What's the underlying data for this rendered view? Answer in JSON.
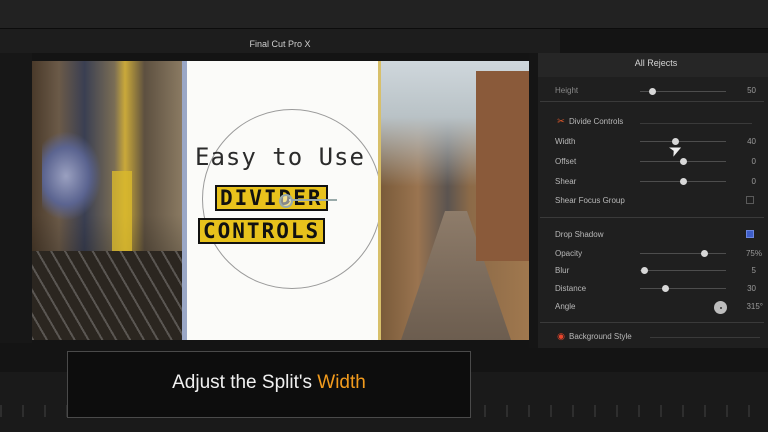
{
  "app": {
    "title": "Final Cut Pro X"
  },
  "inspector": {
    "title": "All Rejects",
    "height_row": {
      "label": "Height",
      "value": "50"
    },
    "divide_controls": {
      "label": "Divide Controls",
      "rows": [
        {
          "label": "Width",
          "value": "40",
          "level": 0.45
        },
        {
          "label": "Offset",
          "value": "0",
          "level": 0.5
        },
        {
          "label": "Shear",
          "value": "0",
          "level": 0.5
        }
      ],
      "shear_focus_group": {
        "label": "Shear Focus Group",
        "checked": false
      }
    },
    "drop_shadow": {
      "label": "Drop Shadow",
      "checked": true,
      "rows": [
        {
          "label": "Opacity",
          "value": "75%",
          "level": 0.75
        },
        {
          "label": "Blur",
          "value": "5",
          "level": 0.05
        },
        {
          "label": "Distance",
          "value": "30",
          "level": 0.3
        }
      ],
      "angle": {
        "label": "Angle",
        "value": "315°"
      }
    },
    "background_style": {
      "label": "Background Style"
    }
  },
  "viewer": {
    "handwritten_text": "Easy to Use",
    "stamp_line1": "DIVIDER",
    "stamp_line2": "CONTROLS"
  },
  "caption": {
    "prefix": "Adjust the Split's ",
    "highlight": "Width"
  },
  "colors": {
    "accent": "#f29b1d",
    "check_blue": "#3e5ec9",
    "stamp_yellow": "#e8c21c"
  }
}
